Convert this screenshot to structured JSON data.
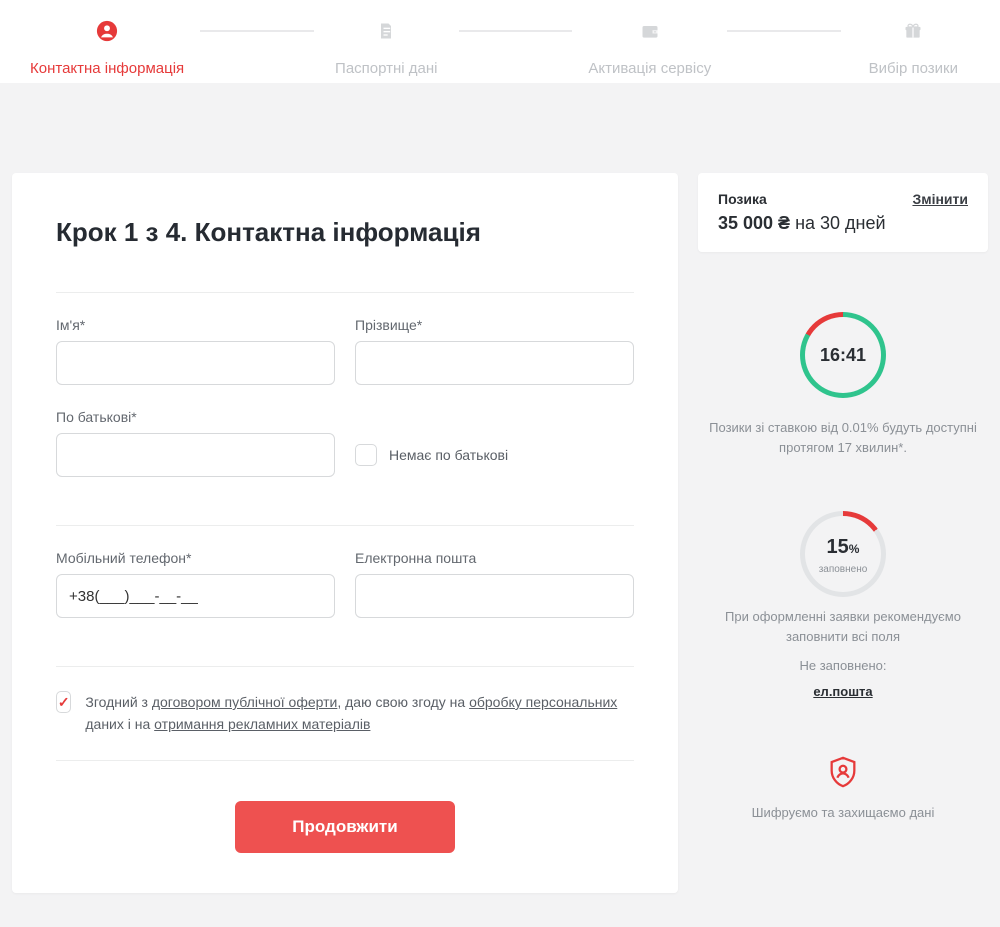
{
  "stepper": {
    "steps": [
      {
        "label": "Контактна інформація",
        "active": true
      },
      {
        "label": "Паспортні дані",
        "active": false
      },
      {
        "label": "Активація сервісу",
        "active": false
      },
      {
        "label": "Вибір позики",
        "active": false
      }
    ]
  },
  "form": {
    "title": "Крок 1 з 4. Контактна інформація",
    "first_name_label": "Ім'я*",
    "last_name_label": "Прізвище*",
    "patronymic_label": "По батькові*",
    "no_patronymic_label": "Немає по батькові",
    "phone_label": "Мобільний телефон*",
    "phone_value": "+38(___)___-__-__",
    "email_label": "Електронна пошта",
    "consent_prefix": "Згодний з ",
    "consent_link1": "договором публічної оферти",
    "consent_mid1": ", даю свою згоду на ",
    "consent_link2": "обробку персональних",
    "consent_mid2": " даних і на ",
    "consent_link3": "отримання рекламних матеріалів",
    "continue_btn": "Продовжити"
  },
  "loan": {
    "title": "Позика",
    "change": "Змінити",
    "amount": "35 000 ₴",
    "duration": " на 30 дней"
  },
  "timer": {
    "value": "16:41",
    "note": "Позики зі ставкою від 0.01% будуть доступні протягом 17 хвилин*."
  },
  "progress": {
    "percent": "15",
    "percent_suffix": "%",
    "sub": "заповнено",
    "note1": "При оформленні заявки рекомендуємо заповнити всі поля",
    "note2": "Не заповнено:",
    "missing": "ел.пошта"
  },
  "security_note": "Шифруємо та захищаємо дані"
}
